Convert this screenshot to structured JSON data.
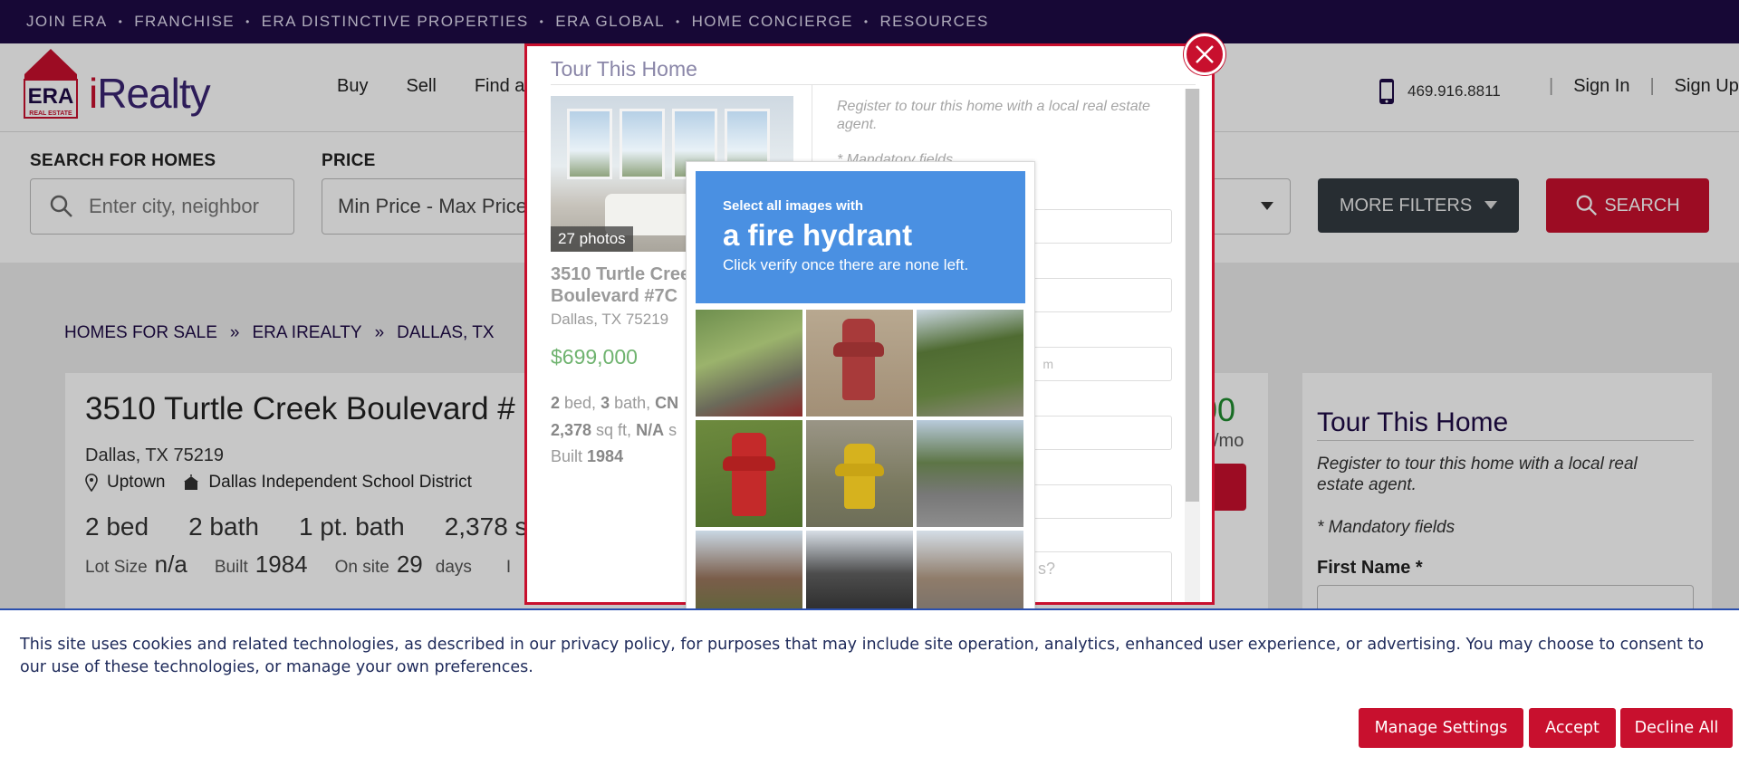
{
  "topnav": [
    "JOIN ERA",
    "FRANCHISE",
    "ERA DISTINCTIVE PROPERTIES",
    "ERA GLOBAL",
    "HOME CONCIERGE",
    "RESOURCES"
  ],
  "topnav_sep": "•",
  "header": {
    "brand_mark": "ERA",
    "brand_sub": "REAL ESTATE",
    "logo_i": "i",
    "logo_text": "Realty",
    "nav": [
      "Buy",
      "Sell",
      "Find a"
    ],
    "phone": "469.916.8811",
    "sign_in": "Sign In",
    "sign_up": "Sign Up",
    "divider": "|"
  },
  "search": {
    "label": "SEARCH FOR HOMES",
    "placeholder": "Enter city, neighbor",
    "price_label": "PRICE",
    "price_value": "Min Price  -  Max Price",
    "more_filters": "MORE FILTERS",
    "search_button": "SEARCH"
  },
  "breadcrumb": [
    "HOMES FOR SALE",
    "ERA IREALTY",
    "DALLAS, TX"
  ],
  "breadcrumb_sep": "»",
  "listing": {
    "title": "3510 Turtle Creek Boulevard #",
    "city": "Dallas, TX 75219",
    "neighborhood": "Uptown",
    "school": "Dallas Independent School District",
    "beds": "2 bed",
    "baths": "2 bath",
    "pt_bath": "1 pt. bath",
    "sqft": "2,378 sq f",
    "lot_label": "Lot Size",
    "lot_value": "n/a",
    "built_label": "Built",
    "built_value": "1984",
    "onsite_label": "On site",
    "onsite_value": "29",
    "onsite_unit": "days",
    "trail": "I",
    "price_fragment": "00",
    "per_month": "/mo"
  },
  "tour_side": {
    "title": "Tour This Home",
    "desc": "Register to tour this home with a local real estate agent.",
    "mandatory": "* Mandatory fields",
    "first_name": "First Name *"
  },
  "modal": {
    "title": "Tour This Home",
    "photos_badge": "27 photos",
    "address": "3510 Turtle Cree Boulevard #7C",
    "city": "Dallas, TX 75219",
    "price": "$699,000",
    "beds_n": "2",
    "beds_u": " bed, ",
    "baths_n": "3",
    "baths_u": " bath, ",
    "type": "CN",
    "sqft_n": "2,378",
    "sqft_u": " sq ft, ",
    "lot": "N/A",
    "lot_u": " s",
    "built_label": "Built ",
    "built": "1984",
    "register": "Register to tour this home with a local real estate agent.",
    "mandatory": "* Mandatory fields",
    "email_hint": "m",
    "textarea_hint": "s?"
  },
  "captcha": {
    "line1": "Select all images with",
    "target": "a fire hydrant",
    "line3": "Click verify once there are none left."
  },
  "cookie": {
    "text": "This site uses cookies and related technologies, as described in our privacy policy, for purposes that may include site operation, analytics, enhanced user experience, or advertising. You may choose to consent to our use of these technologies, or manage your own preferences.",
    "manage": "Manage Settings",
    "accept": "Accept",
    "decline": "Decline All"
  },
  "colors": {
    "brand_purple": "#1e0b46",
    "brand_red": "#c8102e",
    "captcha_blue": "#4a90e2",
    "price_green": "#6fb36f"
  },
  "icons": [
    "search-icon",
    "phone-icon",
    "pin-icon",
    "school-icon",
    "chevron-down-icon",
    "close-icon"
  ]
}
